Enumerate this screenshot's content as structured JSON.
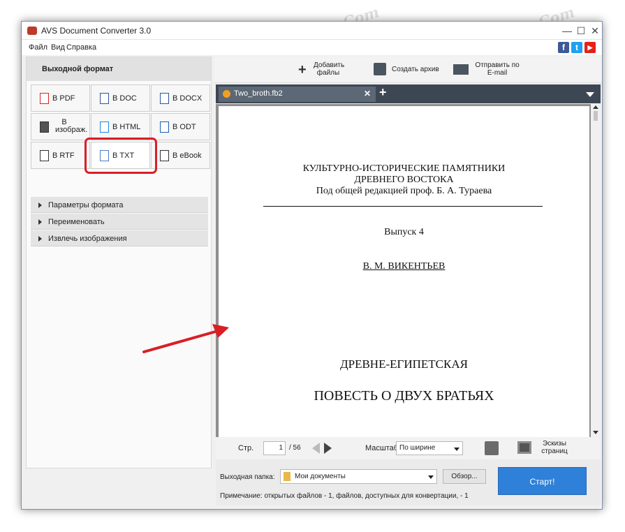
{
  "window": {
    "title": "AVS Document Converter 3.0",
    "minimize": "—",
    "maximize": "☐",
    "close": "✕"
  },
  "menu": [
    "Файл",
    "Вид",
    "Справка"
  ],
  "social": {
    "facebook": "f",
    "twitter": "t",
    "youtube": "▶"
  },
  "left_panel": {
    "header": "Выходной формат",
    "formats": [
      {
        "label": "В PDF",
        "icon": "pdf-file-icon"
      },
      {
        "label": "В DOC",
        "icon": "doc-file-icon"
      },
      {
        "label": "В DOCX",
        "icon": "docx-file-icon"
      },
      {
        "label": "В изображ.",
        "icon": "image-file-icon"
      },
      {
        "label": "В HTML",
        "icon": "html-file-icon"
      },
      {
        "label": "В ODT",
        "icon": "odt-file-icon"
      },
      {
        "label": "В RTF",
        "icon": "rtf-file-icon"
      },
      {
        "label": "В TXT",
        "icon": "txt-file-icon",
        "selected": true
      },
      {
        "label": "В eBook",
        "icon": "ebook-file-icon"
      }
    ],
    "sections": [
      "Параметры формата",
      "Переименовать",
      "Извлечь изображения"
    ]
  },
  "toolbar": {
    "add_files": "Добавить файлы",
    "create_archive": "Создать архив",
    "send_email": "Отправить по E-mail"
  },
  "tab": {
    "name": "Two_broth.fb2",
    "close": "✕",
    "add": "+"
  },
  "document": {
    "line1": "КУЛЬТУРНО-ИСТОРИЧЕСКИЕ ПАМЯТНИКИ",
    "line2": "ДРЕВНЕГО ВОСТОКА",
    "line3": "Под общей редакцией проф. Б. А. Тураева",
    "issue": "Выпуск 4",
    "author": "В. М. ВИКЕНТЬЕВ",
    "subtitle": "ДРЕВНЕ-ЕГИПЕТСКАЯ",
    "title": "ПОВЕСТЬ О ДВУХ БРАТЬЯХ"
  },
  "nav": {
    "page_label": "Стр.",
    "page_value": "1",
    "page_total": "/ 56",
    "zoom_label": "Масштаб",
    "zoom_value": "По ширине",
    "thumbs_label": "Эскизы страниц"
  },
  "output": {
    "folder_label": "Выходная папка:",
    "folder_value": "Мои документы",
    "browse": "Обзор...",
    "start": "Старт!",
    "note": "Примечание: открытых файлов - 1, файлов, доступных для конвертации, - 1"
  },
  "watermark": "Soringpcrepair.Com",
  "colors": {
    "accent_red": "#d81f26",
    "start_blue": "#2f80d9",
    "tab_dark": "#3c4753"
  }
}
